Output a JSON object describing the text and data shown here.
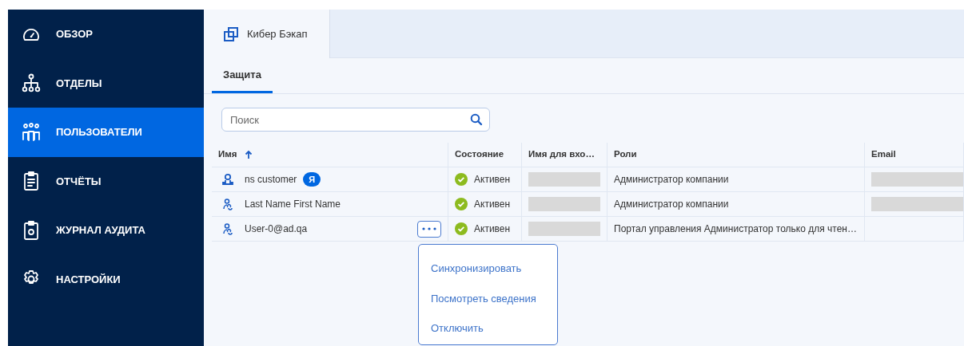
{
  "sidebar": {
    "items": [
      {
        "label": "ОБЗОР",
        "selected": false
      },
      {
        "label": "ОТДЕЛЫ",
        "selected": false
      },
      {
        "label": "ПОЛЬЗОВАТЕЛИ",
        "selected": true
      },
      {
        "label": "ОТЧЁТЫ",
        "selected": false
      },
      {
        "label": "ЖУРНАЛ АУДИТА",
        "selected": false
      },
      {
        "label": "НАСТРОЙКИ",
        "selected": false
      }
    ]
  },
  "product_tab": {
    "label": "Кибер Бэкап"
  },
  "tabs": [
    {
      "label": "Защита",
      "selected": true
    }
  ],
  "search": {
    "placeholder": "Поиск"
  },
  "table": {
    "columns": [
      {
        "label": "Имя",
        "sorted": true
      },
      {
        "label": "Состояние"
      },
      {
        "label": "Имя для вхо…"
      },
      {
        "label": "Роли"
      },
      {
        "label": "Email"
      }
    ],
    "rows": [
      {
        "kind": "local",
        "name": "ns customer",
        "badge": "Я",
        "status": "Активен",
        "login_hidden": true,
        "roles": "Администратор компании",
        "email_hidden": true,
        "menu_open": false
      },
      {
        "kind": "directory",
        "name": "Last Name First Name",
        "status": "Активен",
        "login_hidden": true,
        "roles": "Администратор компании",
        "email_hidden": true,
        "menu_open": false
      },
      {
        "kind": "directory",
        "name": "User-0@ad.qa",
        "status": "Активен",
        "login_hidden": true,
        "roles": "Портал управления Администратор только для чтен…",
        "email_hidden": false,
        "menu_open": true
      }
    ]
  },
  "context_menu": {
    "items": [
      "Синхронизировать",
      "Посмотреть сведения",
      "Отключить"
    ]
  }
}
